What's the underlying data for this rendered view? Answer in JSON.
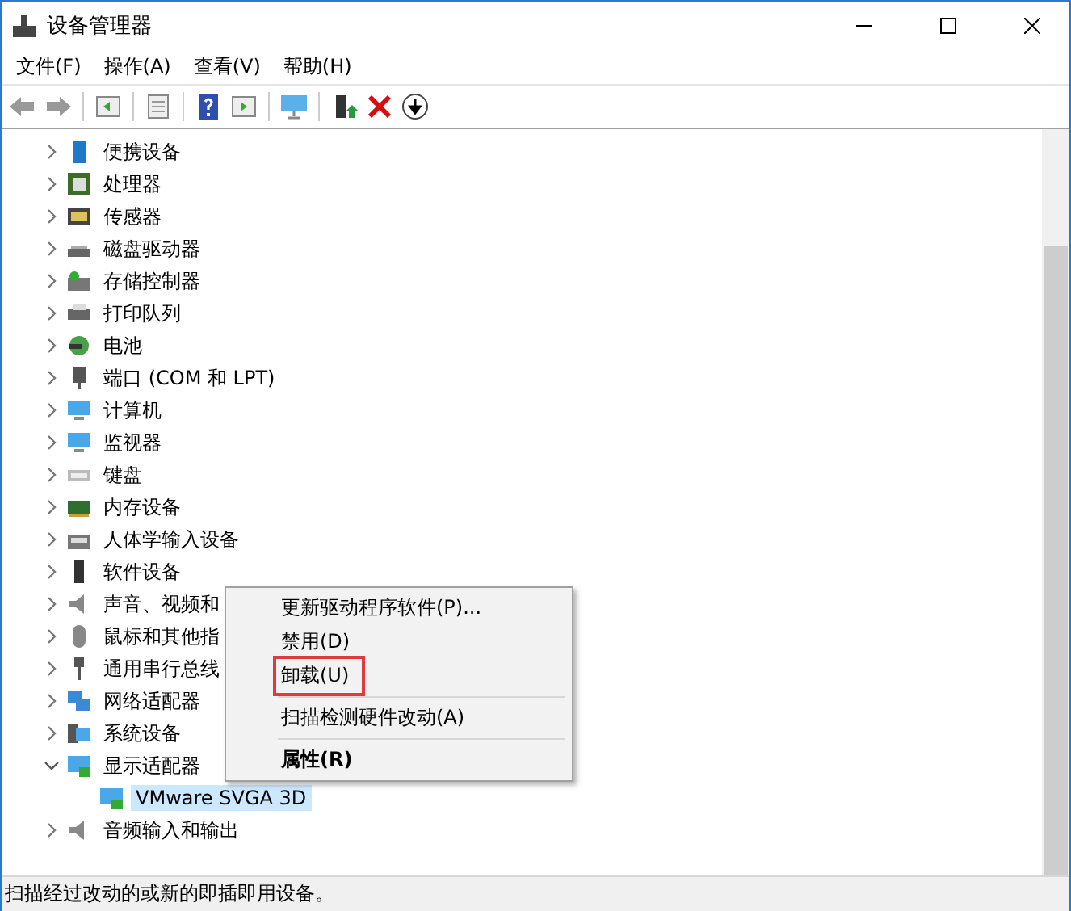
{
  "window": {
    "title": "设备管理器"
  },
  "menu_bar": [
    "文件(F)",
    "操作(A)",
    "查看(V)",
    "帮助(H)"
  ],
  "tree": [
    {
      "label": "便携设备",
      "expanded": false
    },
    {
      "label": "处理器",
      "expanded": false
    },
    {
      "label": "传感器",
      "expanded": false
    },
    {
      "label": "磁盘驱动器",
      "expanded": false
    },
    {
      "label": "存储控制器",
      "expanded": false
    },
    {
      "label": "打印队列",
      "expanded": false
    },
    {
      "label": "电池",
      "expanded": false
    },
    {
      "label": "端口 (COM 和 LPT)",
      "expanded": false
    },
    {
      "label": "计算机",
      "expanded": false
    },
    {
      "label": "监视器",
      "expanded": false
    },
    {
      "label": "键盘",
      "expanded": false
    },
    {
      "label": "内存设备",
      "expanded": false
    },
    {
      "label": "人体学输入设备",
      "expanded": false
    },
    {
      "label": "软件设备",
      "expanded": false
    },
    {
      "label": "声音、视频和",
      "expanded": false
    },
    {
      "label": "鼠标和其他指",
      "expanded": false
    },
    {
      "label": "通用串行总线",
      "expanded": false
    },
    {
      "label": "网络适配器",
      "expanded": false
    },
    {
      "label": "系统设备",
      "expanded": false
    },
    {
      "label": "显示适配器",
      "expanded": true,
      "children": [
        {
          "label": "VMware SVGA 3D",
          "selected": true
        }
      ]
    },
    {
      "label": "音频输入和输出",
      "expanded": false
    }
  ],
  "context_menu": [
    {
      "kind": "item",
      "label": "更新驱动程序软件(P)...",
      "bold": false,
      "highlighted": false
    },
    {
      "kind": "item",
      "label": "禁用(D)",
      "bold": false,
      "highlighted": false
    },
    {
      "kind": "item",
      "label": "卸载(U)",
      "bold": false,
      "highlighted": true
    },
    {
      "kind": "separator"
    },
    {
      "kind": "item",
      "label": "扫描检测硬件改动(A)",
      "bold": false,
      "highlighted": false
    },
    {
      "kind": "separator"
    },
    {
      "kind": "item",
      "label": "属性(R)",
      "bold": true,
      "highlighted": false
    }
  ],
  "status_bar": "扫描经过改动的或新的即插即用设备。"
}
